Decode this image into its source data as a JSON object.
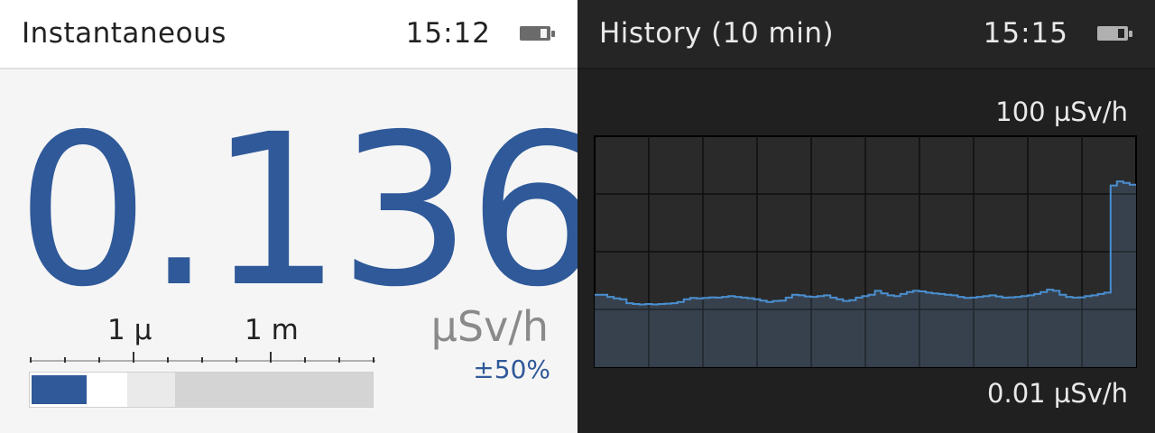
{
  "instant": {
    "title": "Instantaneous",
    "time": "15:12",
    "reading": "0.136",
    "unit": "µSv/h",
    "uncertainty": "±50%",
    "scale_labels": [
      "1 µ",
      "1 m"
    ],
    "bar_level_fraction": 0.16,
    "colors": {
      "accent": "#2f5999",
      "background": "#f5f5f5"
    }
  },
  "history": {
    "title": "History (10 min)",
    "time": "15:15",
    "max_label": "100 µSv/h",
    "min_label": "0.01 µSv/h",
    "colors": {
      "line": "#4a8fd0",
      "fill": "#384452",
      "background": "#202020"
    }
  },
  "chart_data": {
    "type": "area",
    "title": "",
    "xlabel": "",
    "ylabel": "",
    "y_scale": "log",
    "ylim": [
      0.01,
      100
    ],
    "grid": true,
    "series": [
      {
        "values": [
          0.18,
          0.18,
          0.165,
          0.155,
          0.15,
          0.128,
          0.124,
          0.122,
          0.124,
          0.122,
          0.124,
          0.126,
          0.128,
          0.135,
          0.15,
          0.158,
          0.155,
          0.158,
          0.162,
          0.16,
          0.165,
          0.17,
          0.165,
          0.16,
          0.156,
          0.15,
          0.142,
          0.135,
          0.14,
          0.142,
          0.16,
          0.18,
          0.175,
          0.168,
          0.165,
          0.17,
          0.175,
          0.16,
          0.15,
          0.14,
          0.145,
          0.16,
          0.17,
          0.18,
          0.21,
          0.19,
          0.175,
          0.17,
          0.185,
          0.2,
          0.21,
          0.205,
          0.195,
          0.19,
          0.185,
          0.18,
          0.175,
          0.165,
          0.158,
          0.16,
          0.165,
          0.17,
          0.175,
          0.168,
          0.16,
          0.162,
          0.165,
          0.17,
          0.175,
          0.185,
          0.2,
          0.22,
          0.21,
          0.18,
          0.165,
          0.16,
          0.162,
          0.17,
          0.175,
          0.185,
          0.195,
          14.0,
          16.5,
          15.5,
          14.5
        ]
      }
    ]
  }
}
